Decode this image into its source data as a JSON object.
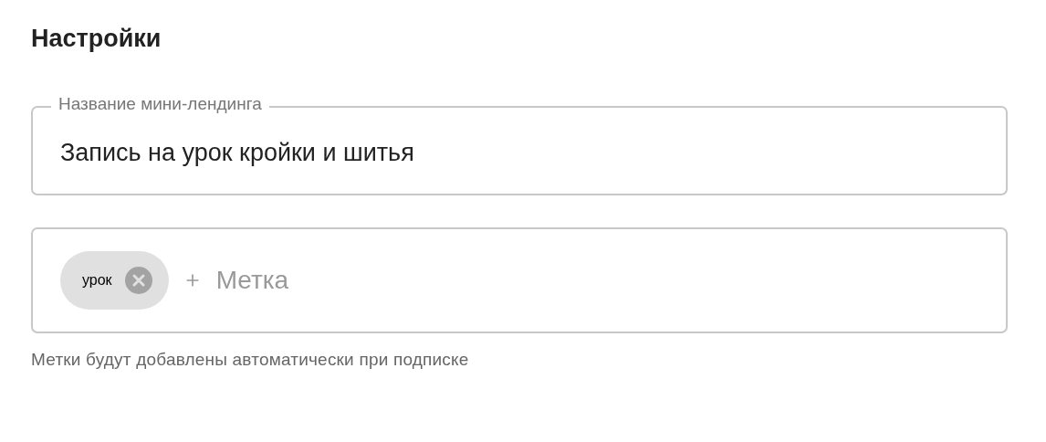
{
  "title": "Настройки",
  "name_field": {
    "label": "Название мини-лендинга",
    "value": "Запись на урок кройки и шитья"
  },
  "tags_field": {
    "tags": [
      {
        "label": "урок"
      }
    ],
    "placeholder": "Метка"
  },
  "helper_text": "Метки будут добавлены автоматически при подписке"
}
